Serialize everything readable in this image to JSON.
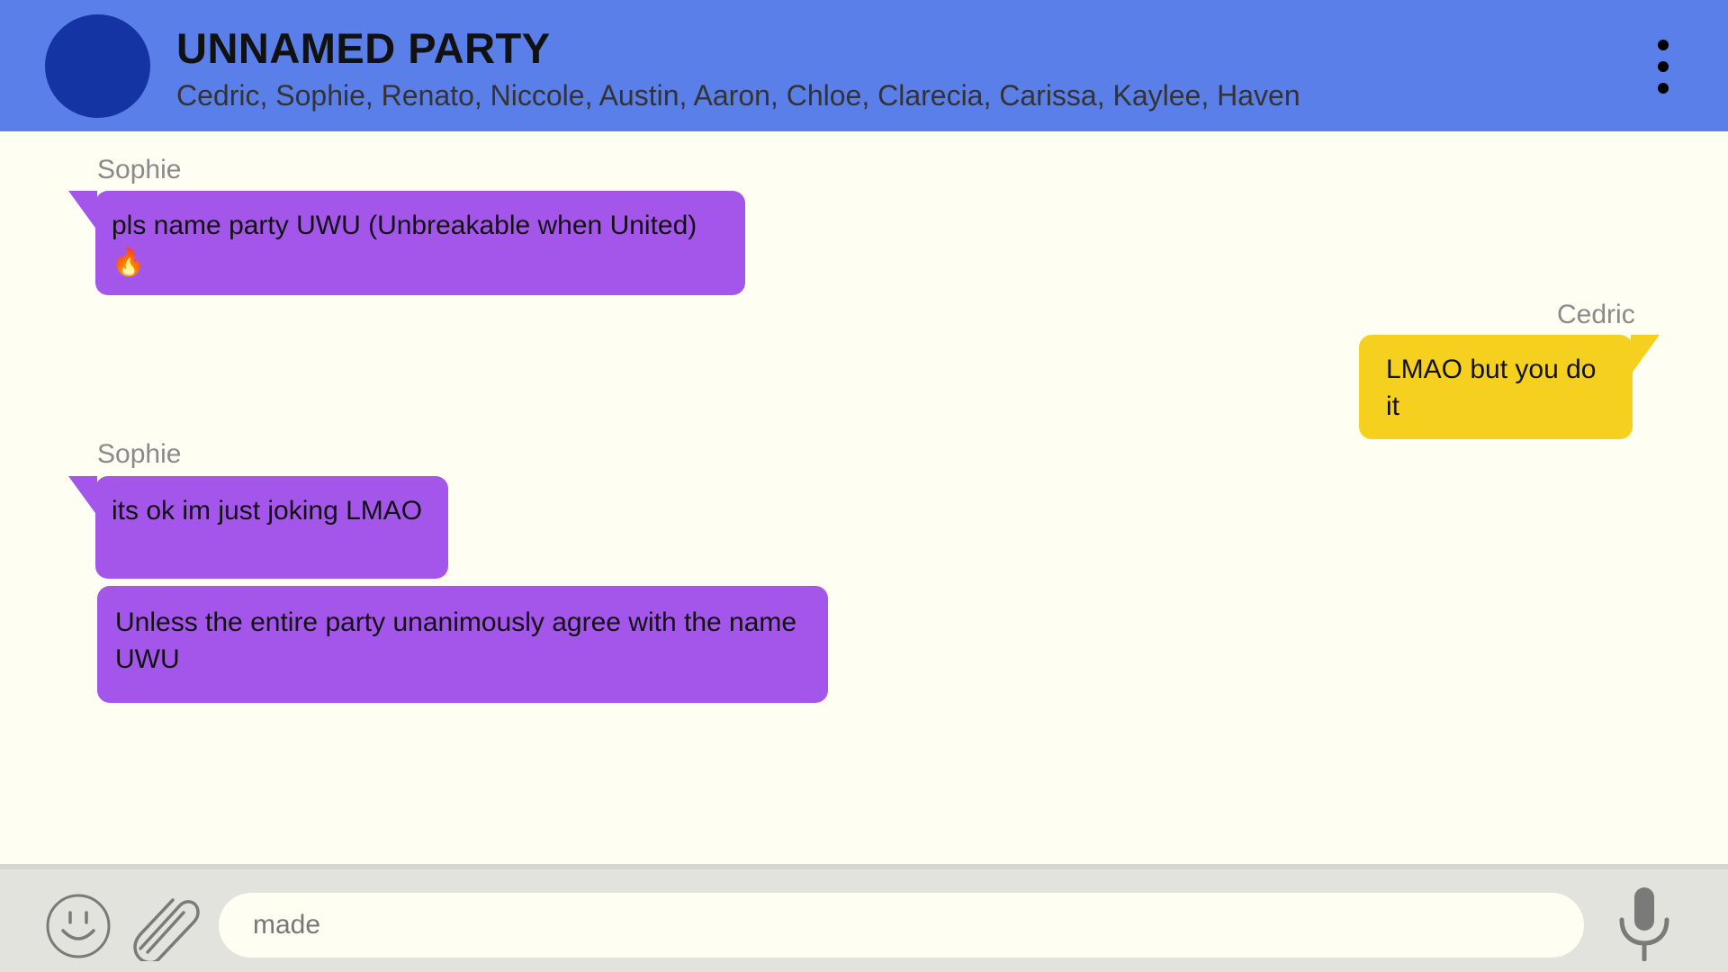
{
  "header": {
    "title": "UNNAMED PARTY",
    "members": "Cedric, Sophie, Renato, Niccole, Austin, Aaron, Chloe, Clarecia, Carissa, Kaylee, Haven",
    "menu_icon": "more-vertical-icon"
  },
  "messages": [
    {
      "sender": "Sophie",
      "text": "pls name party UWU (Unbreakable when United)🔥",
      "side": "left"
    },
    {
      "sender": "Cedric",
      "text": "LMAO but you do it",
      "side": "right"
    },
    {
      "sender": "Sophie",
      "text": "its ok im just joking LMAO",
      "side": "left"
    },
    {
      "sender": "",
      "text": "Unless the entire party unanimously agree with the name UWU",
      "side": "left"
    }
  ],
  "composer": {
    "value": "made",
    "emoji_icon": "smiley-icon",
    "attach_icon": "paperclip-icon",
    "mic_icon": "microphone-icon"
  },
  "colors": {
    "header": "#5a7fe8",
    "avatar": "#1434a4",
    "bubble_other": "#a456eb",
    "bubble_self": "#f6d01e",
    "background": "#fefef3"
  }
}
